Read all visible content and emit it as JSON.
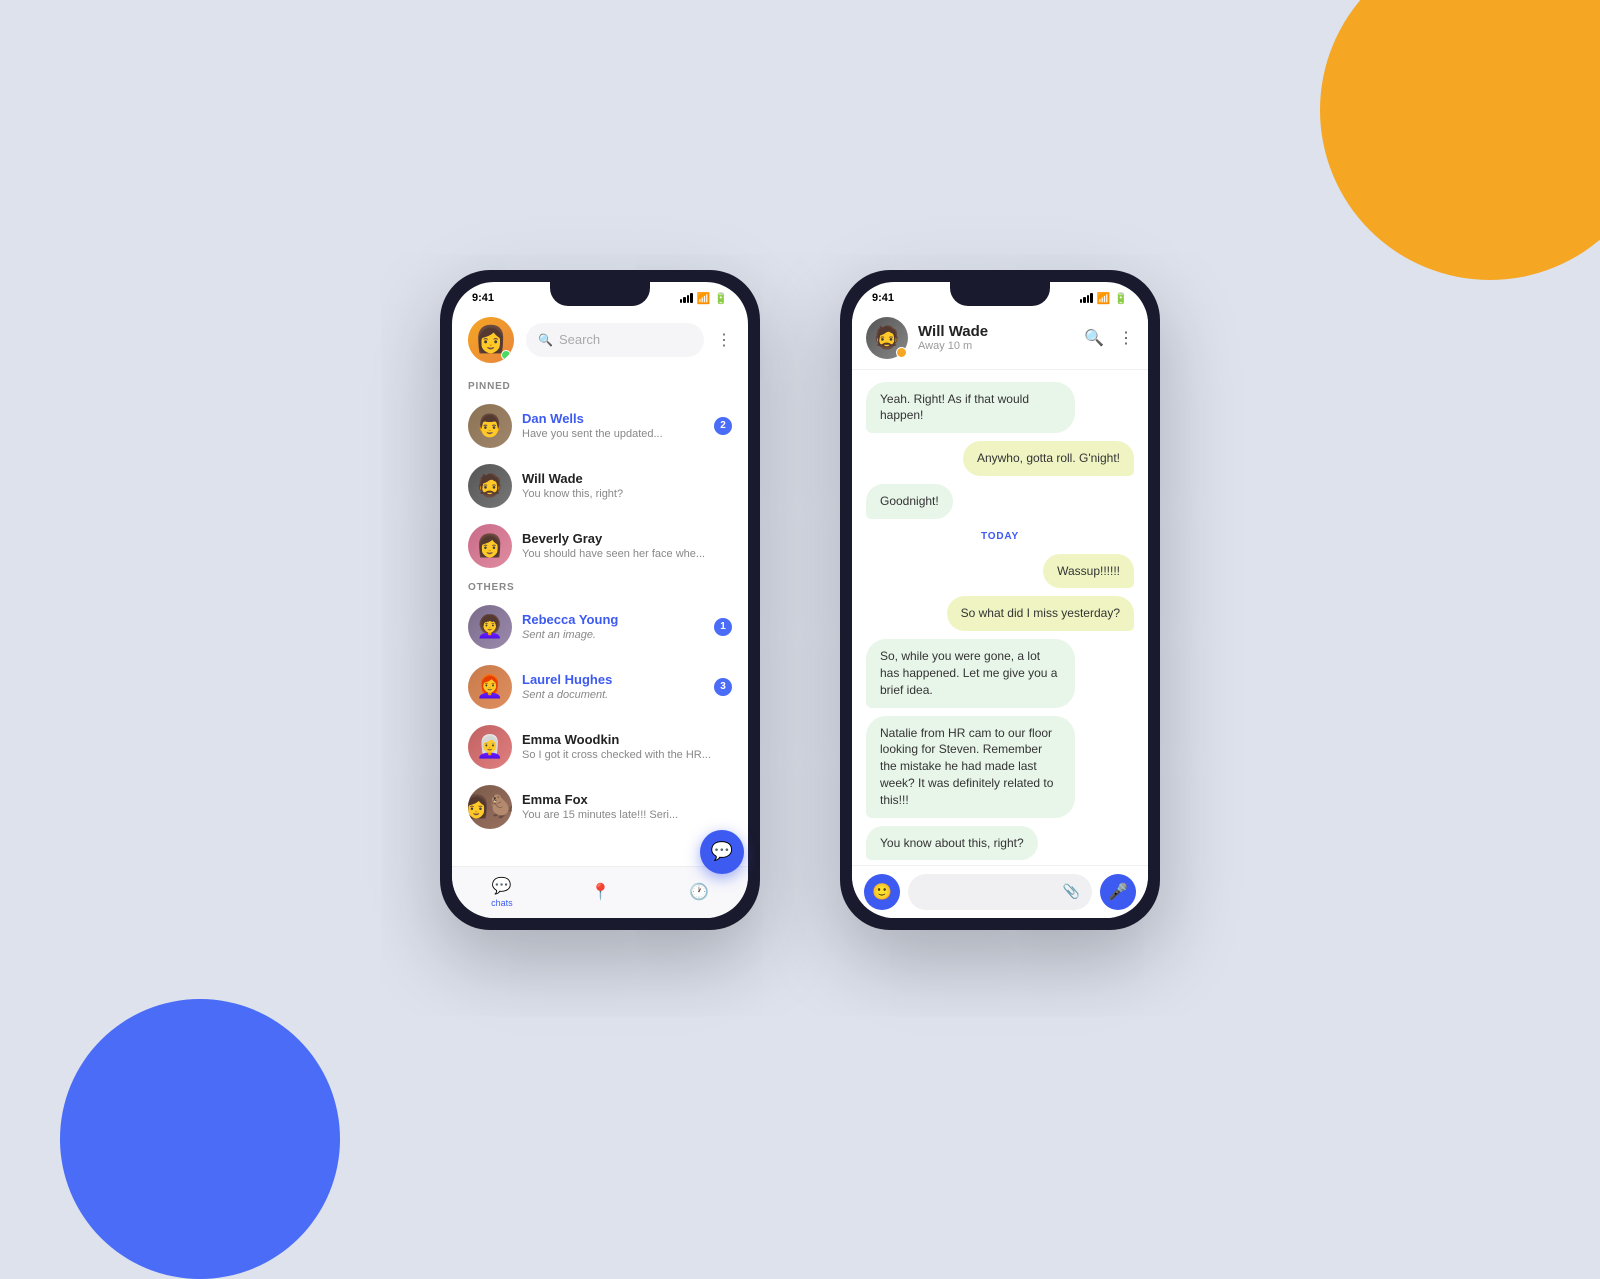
{
  "background": {
    "color": "#dde2ed",
    "orange_blob_color": "#f5a623",
    "blue_blob_color": "#4a6cf7"
  },
  "phone1": {
    "status_time": "9:41",
    "header": {
      "search_placeholder": "Search"
    },
    "pinned_label": "PINNED",
    "others_label": "OTHERS",
    "pinned_chats": [
      {
        "name": "Dan Wells",
        "preview": "Have you sent the updated...",
        "badge": "2",
        "pinned": true
      },
      {
        "name": "Will Wade",
        "preview": "You know this, right?",
        "badge": null,
        "pinned": false
      },
      {
        "name": "Beverly Gray",
        "preview": "You should have seen her face whe...",
        "badge": null,
        "pinned": false
      }
    ],
    "other_chats": [
      {
        "name": "Rebecca Young",
        "preview": "Sent an image.",
        "badge": "1",
        "italic": true
      },
      {
        "name": "Laurel Hughes",
        "preview": "Sent a document.",
        "badge": "3",
        "italic": true
      },
      {
        "name": "Emma Woodkin",
        "preview": "So I got it cross checked with the HR...",
        "badge": null,
        "italic": false
      },
      {
        "name": "Emma Fox",
        "preview": "You are 15 minutes late!!! Seri...",
        "badge": null,
        "italic": false
      }
    ],
    "bottom_nav": [
      {
        "label": "chats",
        "active": true
      },
      {
        "label": "",
        "active": false
      },
      {
        "label": "",
        "active": false
      }
    ]
  },
  "phone2": {
    "status_time": "9:41",
    "header": {
      "contact_name": "Will Wade",
      "contact_status": "Away 10 m"
    },
    "messages": [
      {
        "text": "Yeah. Right! As if that would happen!",
        "type": "received"
      },
      {
        "text": "Anywho, gotta roll. G'night!",
        "type": "sent"
      },
      {
        "text": "Goodnight!",
        "type": "received"
      },
      {
        "date_divider": "TODAY"
      },
      {
        "text": "Wassup!!!!!!",
        "type": "sent"
      },
      {
        "text": "So what did I miss yesterday?",
        "type": "sent"
      },
      {
        "text": "So, while you were gone, a lot has happened. Let me give you a brief idea.",
        "type": "received"
      },
      {
        "text": "Natalie from HR cam to our floor looking for Steven. Remember the mistake he had made last week? It was definitely related to this!!!",
        "type": "received"
      },
      {
        "text": "You know about this, right?",
        "type": "received"
      }
    ]
  }
}
